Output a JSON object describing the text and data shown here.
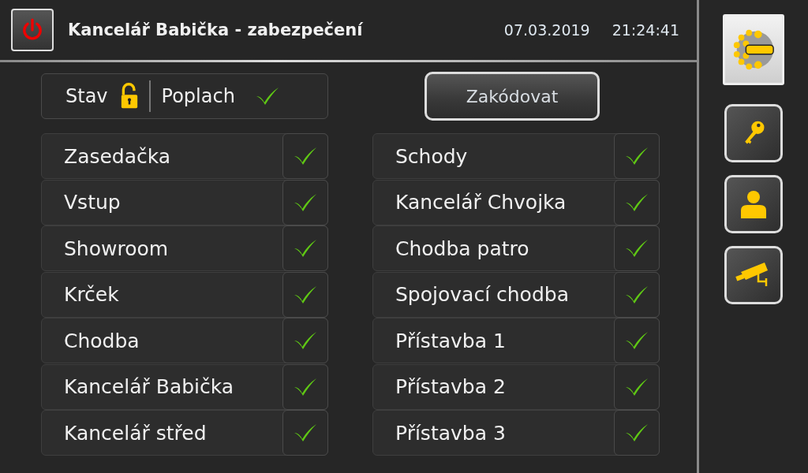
{
  "header": {
    "title": "Kancelář Babička - zabezpečení",
    "date": "07.03.2019",
    "time": "21:24:41"
  },
  "status": {
    "state_label": "Stav",
    "locked": false,
    "alarm_label": "Poplach",
    "alarm_ok": true
  },
  "arm_button": "Zakódovat",
  "zones_left": [
    {
      "name": "Zasedačka",
      "ok": true
    },
    {
      "name": "Vstup",
      "ok": true
    },
    {
      "name": "Showroom",
      "ok": true
    },
    {
      "name": "Krček",
      "ok": true
    },
    {
      "name": "Chodba",
      "ok": true
    },
    {
      "name": "Kancelář Babička",
      "ok": true
    },
    {
      "name": "Kancelář střed",
      "ok": true
    }
  ],
  "zones_right": [
    {
      "name": "Schody",
      "ok": true
    },
    {
      "name": "Kancelář Chvojka",
      "ok": true
    },
    {
      "name": "Chodba patro",
      "ok": true
    },
    {
      "name": "Spojovací chodba",
      "ok": true
    },
    {
      "name": "Přístavba 1",
      "ok": true
    },
    {
      "name": "Přístavba 2",
      "ok": true
    },
    {
      "name": "Přístavba 3",
      "ok": true
    }
  ],
  "sidebar": [
    {
      "kind": "logo"
    },
    {
      "kind": "key"
    },
    {
      "kind": "user"
    },
    {
      "kind": "camera"
    }
  ]
}
